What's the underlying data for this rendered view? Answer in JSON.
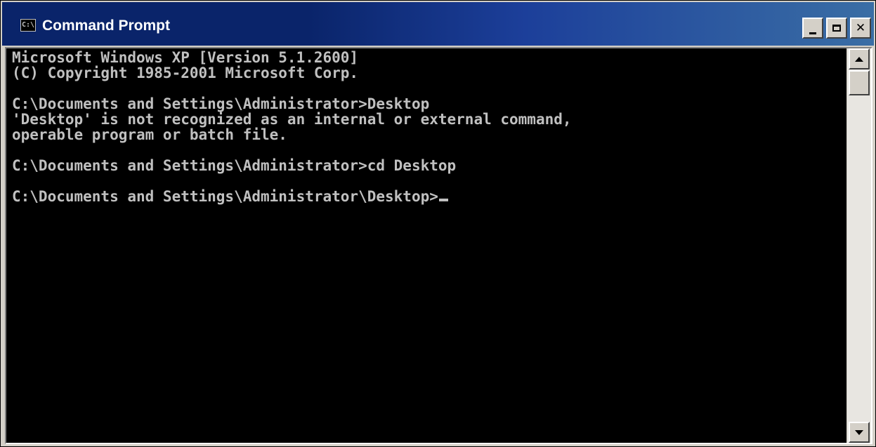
{
  "window": {
    "title": "Command Prompt",
    "icon": "console-app-icon",
    "icon_text": "C:\\"
  },
  "caption_buttons": {
    "minimize": "minimize-icon",
    "maximize": "maximize-icon",
    "close": "close-icon",
    "close_glyph": "✕"
  },
  "console": {
    "lines": [
      "Microsoft Windows XP [Version 5.1.2600]",
      "(C) Copyright 1985-2001 Microsoft Corp.",
      "",
      "C:\\Documents and Settings\\Administrator>Desktop",
      "'Desktop' is not recognized as an internal or external command,",
      "operable program or batch file.",
      "",
      "C:\\Documents and Settings\\Administrator>cd Desktop",
      "",
      "C:\\Documents and Settings\\Administrator\\Desktop>"
    ],
    "colors": {
      "background": "#000000",
      "text": "#c0c0c0"
    }
  },
  "scrollbar": {
    "up": "scroll-up-icon",
    "down": "scroll-down-icon"
  },
  "colors": {
    "titlebar_start": "#0a246a",
    "titlebar_end": "#3a6ea5",
    "chrome": "#d4d0c8"
  }
}
